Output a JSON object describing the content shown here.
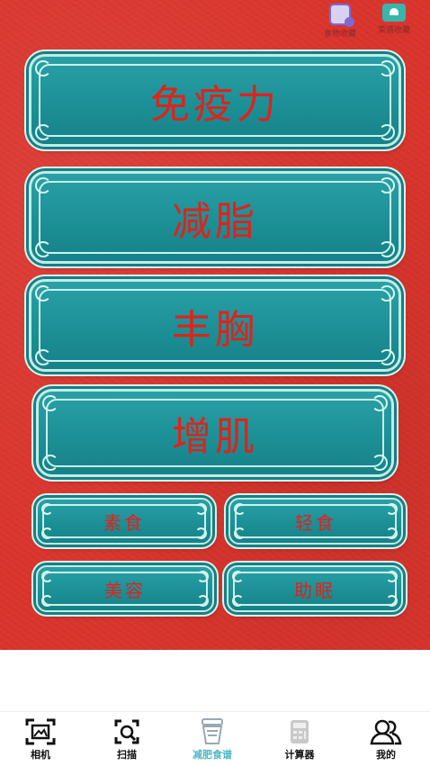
{
  "top_shortcuts": [
    {
      "label": "食物收藏",
      "icon": "food-favorites-icon"
    },
    {
      "label": "菜谱收藏",
      "icon": "recipe-favorites-icon"
    }
  ],
  "categories_large": [
    "免疫力",
    "减脂",
    "丰胸",
    "增肌"
  ],
  "categories_small": [
    "素食",
    "轻食",
    "美容",
    "助眠"
  ],
  "tabs": [
    {
      "label": "相机",
      "icon": "camera-frame-icon"
    },
    {
      "label": "扫描",
      "icon": "scan-icon"
    },
    {
      "label": "减肥食谱",
      "icon": "diet-recipe-icon",
      "active": true
    },
    {
      "label": "计算器",
      "icon": "calculator-icon"
    },
    {
      "label": "我的",
      "icon": "user-profile-icon"
    }
  ],
  "colors": {
    "background_red": "#d9342c",
    "panel_teal": "#1c9096",
    "panel_text_red": "#e0221b",
    "active_tab": "#4fb8c4"
  }
}
